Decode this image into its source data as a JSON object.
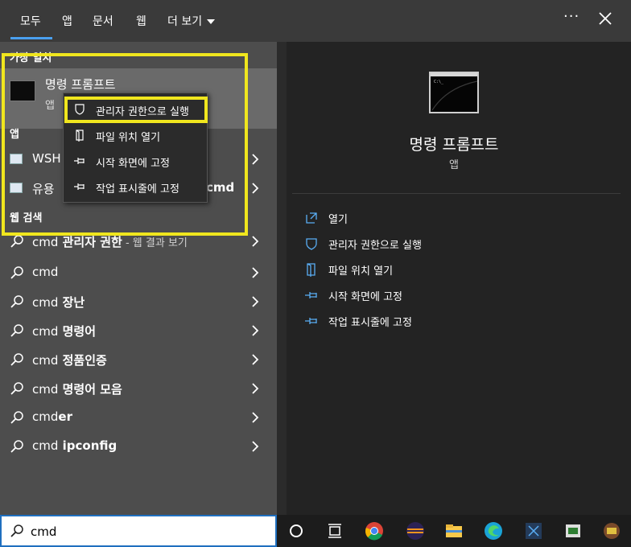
{
  "tabs": [
    "모두",
    "앱",
    "문서",
    "웹",
    "더 보기"
  ],
  "header": {
    "more_options_icon": "ellipsis-icon",
    "close_icon": "close-icon"
  },
  "left": {
    "best_match_heading": "가장 일치",
    "best_match": {
      "title": "명령 프롬프트",
      "subtitle": "앱"
    },
    "apps_heading": "앱",
    "apps": [
      {
        "label": "WSH",
        "icon": "wsh-icon"
      },
      {
        "label": "유용",
        "bold_suffix": "cmd",
        "icon": "utility-icon"
      }
    ],
    "web_heading": "웹 검색",
    "web_results": [
      {
        "plain": "cmd",
        "bold": " 관리자 권한",
        "suffix": " - 웹 결과 보기"
      },
      {
        "plain": "cmd",
        "bold": "",
        "suffix": ""
      },
      {
        "plain": "cmd",
        "bold": " 장난",
        "suffix": ""
      },
      {
        "plain": "cmd",
        "bold": " 명령어",
        "suffix": ""
      },
      {
        "plain": "cmd",
        "bold": " 정품인증",
        "suffix": ""
      },
      {
        "plain": "cmd",
        "bold": " 명령어 모음",
        "suffix": ""
      },
      {
        "plain": "cmd",
        "bold": "er",
        "suffix": ""
      },
      {
        "plain": "cmd",
        "bold": " ipconfig",
        "suffix": ""
      }
    ]
  },
  "context_menu": [
    {
      "label": "관리자 권한으로 실행",
      "icon": "shield-icon"
    },
    {
      "label": "파일 위치 열기",
      "icon": "folder-icon"
    },
    {
      "label": "시작 화면에 고정",
      "icon": "pin-icon"
    },
    {
      "label": "작업 표시줄에 고정",
      "icon": "pin-icon"
    }
  ],
  "right": {
    "title": "명령 프롬프트",
    "subtitle": "앱",
    "actions": [
      {
        "label": "열기",
        "icon": "open-icon"
      },
      {
        "label": "관리자 권한으로 실행",
        "icon": "shield-icon"
      },
      {
        "label": "파일 위치 열기",
        "icon": "folder-icon"
      },
      {
        "label": "시작 화면에 고정",
        "icon": "pin-icon"
      },
      {
        "label": "작업 표시줄에 고정",
        "icon": "pin-icon"
      }
    ]
  },
  "search": {
    "value": "cmd"
  },
  "taskbar": [
    "cortana-icon",
    "task-view-icon",
    "chrome-icon",
    "eclipse-icon",
    "file-explorer-icon",
    "edge-icon",
    "vscode-icon",
    "app-icon",
    "app-icon-2"
  ],
  "colors": {
    "accent": "#4aa0f0",
    "highlight": "#f0e61e",
    "left_bg": "#4d4d4d",
    "right_bg": "#232323"
  }
}
